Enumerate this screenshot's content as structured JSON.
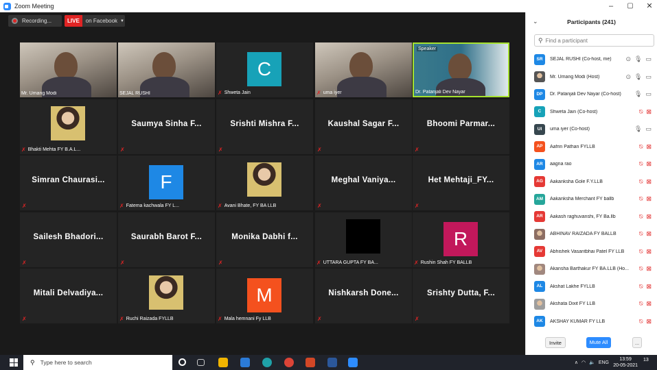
{
  "window": {
    "title": "Zoom Meeting",
    "minimize": "–",
    "maximize": "▢",
    "close": "✕"
  },
  "toolbar": {
    "recording_label": "Recording...",
    "live_badge": "LIVE",
    "live_target": "on Facebook"
  },
  "tiles": [
    {
      "kind": "video",
      "label": "Mr. Umang Modi"
    },
    {
      "kind": "video",
      "label": "SEJAL RUSHI"
    },
    {
      "kind": "letter",
      "letter": "C",
      "color": "#17a2b8",
      "label": "Shweta Jain"
    },
    {
      "kind": "video",
      "label": "uma iyer"
    },
    {
      "kind": "video",
      "label": "Dr. Patanjali Dev Nayar",
      "speaker": "Speaker"
    },
    {
      "kind": "photo",
      "label": "Bhakti Mehta FY B.A.L..."
    },
    {
      "kind": "name",
      "name": "Saumya Sinha F..."
    },
    {
      "kind": "name",
      "name": "Srishti Mishra F..."
    },
    {
      "kind": "name",
      "name": "Kaushal Sagar F..."
    },
    {
      "kind": "name",
      "name": "Bhoomi Parmar..."
    },
    {
      "kind": "name",
      "name": "Simran Chaurasi..."
    },
    {
      "kind": "letter",
      "letter": "F",
      "color": "#1e88e5",
      "label": "Fatema kachwala FY L..."
    },
    {
      "kind": "photo",
      "label": "Avani Bhate, FY BA LLB"
    },
    {
      "kind": "name",
      "name": "Meghal Vaniya..."
    },
    {
      "kind": "name",
      "name": "Het Mehtaji_FY..."
    },
    {
      "kind": "name",
      "name": "Sailesh Bhadori..."
    },
    {
      "kind": "name",
      "name": "Saurabh Barot F..."
    },
    {
      "kind": "name",
      "name": "Monika Dabhi f..."
    },
    {
      "kind": "black",
      "label": "UTTARA GUPTA FY BA..."
    },
    {
      "kind": "letter",
      "letter": "R",
      "color": "#c2185b",
      "label": "Rushin Shah FY BALLB"
    },
    {
      "kind": "name",
      "name": "Mitali Delvadiya..."
    },
    {
      "kind": "photo",
      "label": "Ruchi Raizada FYLLB"
    },
    {
      "kind": "letter",
      "letter": "M",
      "color": "#f4511e",
      "label": "Mala  hemnani Fy LLB"
    },
    {
      "kind": "name",
      "name": "Nishkarsh Done..."
    },
    {
      "kind": "name",
      "name": "Srishty Dutta,  F..."
    }
  ],
  "panel": {
    "collapse_icon": "⌄",
    "title": "Participants (241)",
    "search_placeholder": "Find a participant",
    "participants": [
      {
        "initials": "SR",
        "color": "#1e88e5",
        "name": "SEJAL RUSHI (Co-host, me)",
        "muted": false,
        "video": true
      },
      {
        "initials": "",
        "color": "#555555",
        "name": "Mr. Umang Modi (Host)",
        "muted": false,
        "video": true,
        "photo": true
      },
      {
        "initials": "DP",
        "color": "#1e88e5",
        "name": "Dr. Patanjali Dev Nayar (Co-host)",
        "muted": false,
        "video": true
      },
      {
        "initials": "C",
        "color": "#17a2b8",
        "name": "Shweta Jain (Co-host)",
        "muted": true,
        "video": false
      },
      {
        "initials": "UI",
        "color": "#37474f",
        "name": "uma iyer (Co-host)",
        "muted": false,
        "video": true
      },
      {
        "initials": "AP",
        "color": "#f4511e",
        "name": "Aafrin Pathan FYLLB",
        "muted": true,
        "video": false
      },
      {
        "initials": "AR",
        "color": "#1e88e5",
        "name": "aagna rao",
        "muted": true,
        "video": false
      },
      {
        "initials": "AG",
        "color": "#e53935",
        "name": "Aakanksha Gole F.Y.LLB",
        "muted": true,
        "video": false
      },
      {
        "initials": "AM",
        "color": "#26a69a",
        "name": "Aakanksha Merchant FY ballb",
        "muted": true,
        "video": false
      },
      {
        "initials": "AR",
        "color": "#e53935",
        "name": "Aakash raghuvanshi, FY Ba.llb",
        "muted": true,
        "video": false
      },
      {
        "initials": "",
        "color": "#8d6e63",
        "name": "ABHINAV RAIZADA FY BALLB",
        "muted": true,
        "video": false,
        "photo": true
      },
      {
        "initials": "AV",
        "color": "#e53935",
        "name": "Abhishek Vasantbhai Patel FY LLB",
        "muted": true,
        "video": false
      },
      {
        "initials": "",
        "color": "#a1887f",
        "name": "Akansha Barthakur FY BA.LLB (Ho...",
        "muted": true,
        "video": false,
        "photo": true
      },
      {
        "initials": "AL",
        "color": "#1e88e5",
        "name": "Akshat Lakhe FYLLB",
        "muted": true,
        "video": false
      },
      {
        "initials": "",
        "color": "#9e9e9e",
        "name": "Akshata Dixit FY LLB",
        "muted": true,
        "video": false,
        "photo": true
      },
      {
        "initials": "AK",
        "color": "#1e88e5",
        "name": "AKSHAY KUMAR FY LLB",
        "muted": true,
        "video": false
      }
    ],
    "invite_label": "Invite",
    "mute_all_label": "Mute All",
    "more_label": "..."
  },
  "taskbar": {
    "search_placeholder": "Type here to search",
    "tray_lang": "ENG",
    "time": "13:59",
    "date": "20-05-2021",
    "notification_count": "13"
  }
}
